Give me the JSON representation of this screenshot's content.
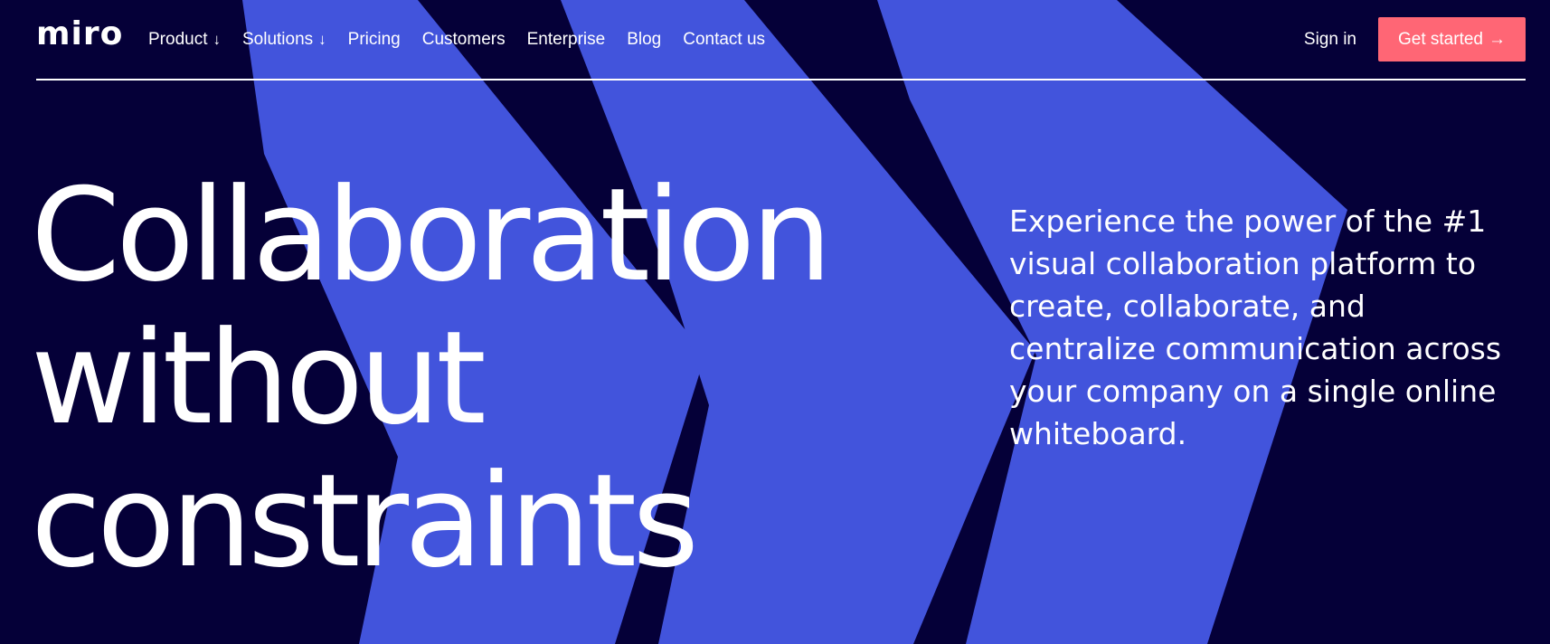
{
  "navbar": {
    "logo": "miro",
    "menu": [
      {
        "label": "Product",
        "dropdown": true
      },
      {
        "label": "Solutions",
        "dropdown": true
      },
      {
        "label": "Pricing",
        "dropdown": false
      },
      {
        "label": "Customers",
        "dropdown": false
      },
      {
        "label": "Enterprise",
        "dropdown": false
      },
      {
        "label": "Blog",
        "dropdown": false
      },
      {
        "label": "Contact us",
        "dropdown": false
      }
    ],
    "dropdown_arrow": "↓",
    "sign_in": "Sign in",
    "cta": {
      "label": "Get started",
      "arrow": "→"
    }
  },
  "hero": {
    "heading_lines": [
      "Collaboration",
      "without",
      "constraints"
    ],
    "description": "Experience the power of the #1 visual collaboration platform to create, collaborate, and centralize communication across your company on a single online whiteboard."
  },
  "colors": {
    "background": "#050038",
    "shape": "#4254dc",
    "accent": "#ff6675",
    "text": "#ffffff"
  },
  "icons": {
    "dropdown": "arrow-down-icon",
    "cta": "arrow-right-icon"
  }
}
